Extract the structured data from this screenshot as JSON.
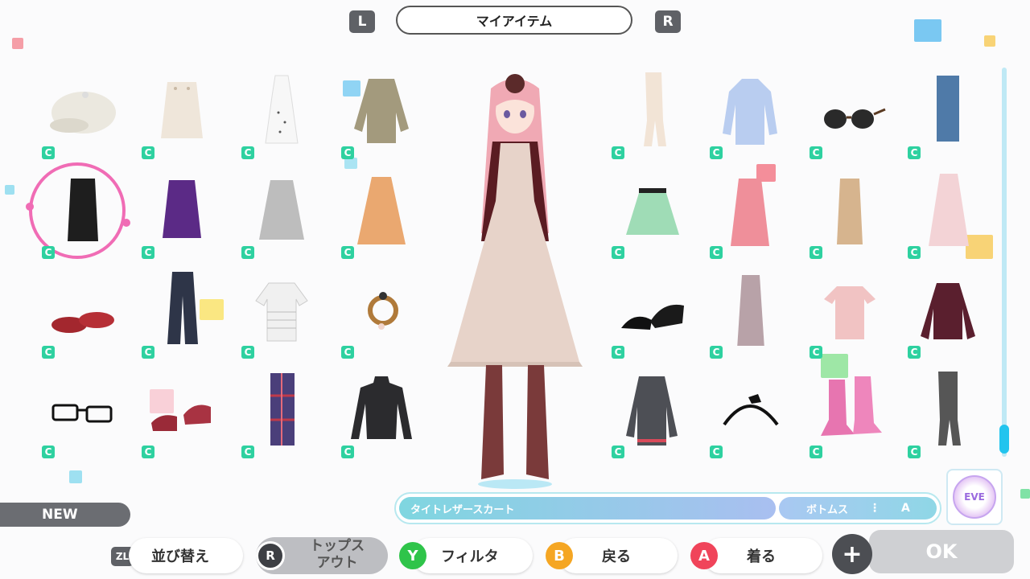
{
  "header": {
    "left_button": "L",
    "title": "マイアイテム",
    "right_button": "R"
  },
  "badge_glyph": "C",
  "items": [
    {
      "icon": "newsboy-cap-icon"
    },
    {
      "icon": "cream-skirt-icon"
    },
    {
      "icon": "white-dress-icon"
    },
    {
      "icon": "khaki-jacket-icon"
    },
    {
      "icon": "pantyhose-icon"
    },
    {
      "icon": "blue-shirt-icon"
    },
    {
      "icon": "sunglasses-icon"
    },
    {
      "icon": "denim-skirt-icon"
    },
    {
      "icon": "leather-skirt-icon",
      "selected": true
    },
    {
      "icon": "purple-skirt-icon"
    },
    {
      "icon": "gingham-skirt-icon"
    },
    {
      "icon": "orange-skirt-icon"
    },
    {
      "icon": "green-skirt-icon"
    },
    {
      "icon": "pink-skirt-icon"
    },
    {
      "icon": "tweed-skirt-icon"
    },
    {
      "icon": "pleated-skirt-icon"
    },
    {
      "icon": "red-flats-icon"
    },
    {
      "icon": "wide-jeans-icon"
    },
    {
      "icon": "striped-tee-icon"
    },
    {
      "icon": "ring-icon"
    },
    {
      "icon": "black-heels-icon"
    },
    {
      "icon": "lace-skirt-icon"
    },
    {
      "icon": "pink-top-icon"
    },
    {
      "icon": "leather-jacket-icon"
    },
    {
      "icon": "glasses-icon"
    },
    {
      "icon": "red-pumps-icon"
    },
    {
      "icon": "plaid-skirt-icon"
    },
    {
      "icon": "turtleneck-icon"
    },
    {
      "icon": "cardigan-icon"
    },
    {
      "icon": "headband-icon"
    },
    {
      "icon": "pink-boots-icon"
    },
    {
      "icon": "grey-tights-icon"
    }
  ],
  "selected_item": {
    "name": "タイトレザースカート",
    "category": "ボトムス",
    "separator": "⋮",
    "rank": "A"
  },
  "eve_label": "EVE",
  "new_label": "NEW",
  "bottom_bar": {
    "zl": "ZL",
    "sort": "並び替え",
    "r_stick": "R",
    "tops_line1": "トップス",
    "tops_line2": "アウト",
    "y_key": "Y",
    "filter": "フィルタ",
    "b_key": "B",
    "back": "戻る",
    "a_key": "A",
    "wear": "着る",
    "plus": "+",
    "ok": "OK"
  },
  "colors": {
    "accent_badge": "#2ed1a0",
    "selection_ring": "#f06cb5",
    "y_button": "#2fc44a",
    "b_button": "#f5a623",
    "a_button": "#f0445a"
  }
}
